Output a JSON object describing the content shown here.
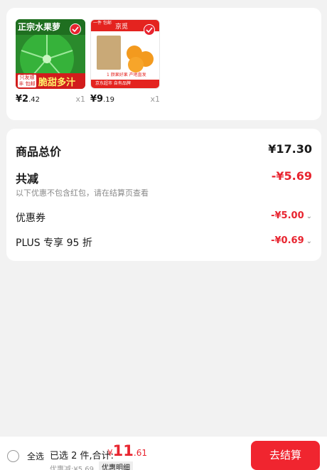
{
  "products": [
    {
      "image_top_text": "正宗水果萝",
      "image_tag": "只发顺丰 包邮",
      "image_bottom_text": "脆甜多汁",
      "price_int": "¥2",
      "price_dec": ".42",
      "qty": "x1"
    },
    {
      "image_top_text": "一件 包邮",
      "image_logo": "京觅",
      "image_ribbon": "1 颜果好果  产地直发",
      "image_footer": "京东超市 自有品牌",
      "price_int": "¥9",
      "price_dec": ".19",
      "qty": "x1"
    }
  ],
  "summary": {
    "total_label": "商品总价",
    "total_value": "¥17.30",
    "reduction_label": "共减",
    "reduction_value": "-¥5.69",
    "reduction_note": "以下优惠不包含红包，请在结算页查看",
    "coupon_label": "优惠券",
    "coupon_value": "-¥5.00",
    "plus_label": "PLUS 专享 95 折",
    "plus_value": "-¥0.69"
  },
  "bottom_bar": {
    "select_all": "全选",
    "selected_text": "已选 2 件,合计:",
    "total_currency": "¥",
    "total_int": "11",
    "total_dec": ".61",
    "discount_line": "优惠减:¥5.69",
    "detail_label": "优惠明细",
    "checkout_label": "去结算"
  },
  "colors": {
    "accent": "#e8242f",
    "background": "#f2f2f2"
  }
}
